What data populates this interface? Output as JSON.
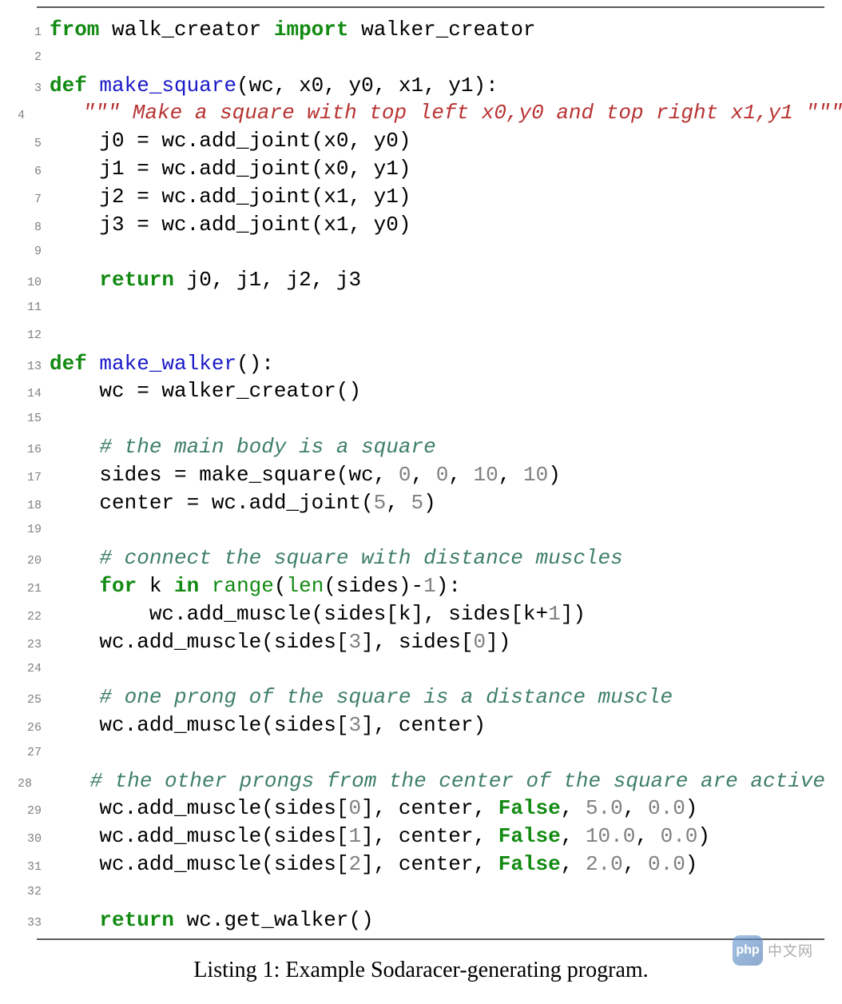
{
  "caption": "Listing 1: Example Sodaracer-generating program.",
  "watermark": {
    "icon_text": "php",
    "label": "中文网"
  },
  "code": [
    {
      "n": 1,
      "segs": [
        {
          "c": "kw-from",
          "t": "from"
        },
        {
          "c": "plain",
          "t": " walk_creator "
        },
        {
          "c": "kw-import",
          "t": "import"
        },
        {
          "c": "plain",
          "t": " walker_creator"
        }
      ]
    },
    {
      "n": 2,
      "segs": []
    },
    {
      "n": 3,
      "segs": [
        {
          "c": "kw-def",
          "t": "def"
        },
        {
          "c": "plain",
          "t": " "
        },
        {
          "c": "fn-name",
          "t": "make_square"
        },
        {
          "c": "plain",
          "t": "(wc, x0, y0, x1, y1):"
        }
      ]
    },
    {
      "n": 4,
      "segs": [
        {
          "c": "plain",
          "t": "    "
        },
        {
          "c": "docstr",
          "t": "\"\"\" Make a square with top left x0,y0 and top right x1,y1 \"\"\""
        }
      ]
    },
    {
      "n": 5,
      "segs": [
        {
          "c": "plain",
          "t": "    j0 = wc.add_joint(x0, y0)"
        }
      ]
    },
    {
      "n": 6,
      "segs": [
        {
          "c": "plain",
          "t": "    j1 = wc.add_joint(x0, y1)"
        }
      ]
    },
    {
      "n": 7,
      "segs": [
        {
          "c": "plain",
          "t": "    j2 = wc.add_joint(x1, y1)"
        }
      ]
    },
    {
      "n": 8,
      "segs": [
        {
          "c": "plain",
          "t": "    j3 = wc.add_joint(x1, y0)"
        }
      ]
    },
    {
      "n": 9,
      "segs": []
    },
    {
      "n": 10,
      "segs": [
        {
          "c": "plain",
          "t": "    "
        },
        {
          "c": "kw-return",
          "t": "return"
        },
        {
          "c": "plain",
          "t": " j0, j1, j2, j3"
        }
      ]
    },
    {
      "n": 11,
      "segs": []
    },
    {
      "n": 12,
      "segs": []
    },
    {
      "n": 13,
      "segs": [
        {
          "c": "kw-def",
          "t": "def"
        },
        {
          "c": "plain",
          "t": " "
        },
        {
          "c": "fn-name",
          "t": "make_walker"
        },
        {
          "c": "plain",
          "t": "():"
        }
      ]
    },
    {
      "n": 14,
      "segs": [
        {
          "c": "plain",
          "t": "    wc = walker_creator()"
        }
      ]
    },
    {
      "n": 15,
      "segs": []
    },
    {
      "n": 16,
      "segs": [
        {
          "c": "plain",
          "t": "    "
        },
        {
          "c": "comment",
          "t": "# the main body is a square"
        }
      ]
    },
    {
      "n": 17,
      "segs": [
        {
          "c": "plain",
          "t": "    sides = make_square(wc, "
        },
        {
          "c": "num",
          "t": "0"
        },
        {
          "c": "plain",
          "t": ", "
        },
        {
          "c": "num",
          "t": "0"
        },
        {
          "c": "plain",
          "t": ", "
        },
        {
          "c": "num",
          "t": "10"
        },
        {
          "c": "plain",
          "t": ", "
        },
        {
          "c": "num",
          "t": "10"
        },
        {
          "c": "plain",
          "t": ")"
        }
      ]
    },
    {
      "n": 18,
      "segs": [
        {
          "c": "plain",
          "t": "    center = wc.add_joint("
        },
        {
          "c": "num",
          "t": "5"
        },
        {
          "c": "plain",
          "t": ", "
        },
        {
          "c": "num",
          "t": "5"
        },
        {
          "c": "plain",
          "t": ")"
        }
      ]
    },
    {
      "n": 19,
      "segs": []
    },
    {
      "n": 20,
      "segs": [
        {
          "c": "plain",
          "t": "    "
        },
        {
          "c": "comment",
          "t": "# connect the square with distance muscles"
        }
      ]
    },
    {
      "n": 21,
      "segs": [
        {
          "c": "plain",
          "t": "    "
        },
        {
          "c": "kw-for",
          "t": "for"
        },
        {
          "c": "plain",
          "t": " k "
        },
        {
          "c": "kw-in",
          "t": "in"
        },
        {
          "c": "plain",
          "t": " "
        },
        {
          "c": "builtin",
          "t": "range"
        },
        {
          "c": "plain",
          "t": "("
        },
        {
          "c": "builtin",
          "t": "len"
        },
        {
          "c": "plain",
          "t": "(sides)-"
        },
        {
          "c": "num",
          "t": "1"
        },
        {
          "c": "plain",
          "t": "):"
        }
      ]
    },
    {
      "n": 22,
      "segs": [
        {
          "c": "plain",
          "t": "        wc.add_muscle(sides[k], sides[k+"
        },
        {
          "c": "num",
          "t": "1"
        },
        {
          "c": "plain",
          "t": "])"
        }
      ]
    },
    {
      "n": 23,
      "segs": [
        {
          "c": "plain",
          "t": "    wc.add_muscle(sides["
        },
        {
          "c": "num",
          "t": "3"
        },
        {
          "c": "plain",
          "t": "], sides["
        },
        {
          "c": "num",
          "t": "0"
        },
        {
          "c": "plain",
          "t": "])"
        }
      ]
    },
    {
      "n": 24,
      "segs": []
    },
    {
      "n": 25,
      "segs": [
        {
          "c": "plain",
          "t": "    "
        },
        {
          "c": "comment",
          "t": "# one prong of the square is a distance muscle"
        }
      ]
    },
    {
      "n": 26,
      "segs": [
        {
          "c": "plain",
          "t": "    wc.add_muscle(sides["
        },
        {
          "c": "num",
          "t": "3"
        },
        {
          "c": "plain",
          "t": "], center)"
        }
      ]
    },
    {
      "n": 27,
      "segs": []
    },
    {
      "n": 28,
      "segs": [
        {
          "c": "plain",
          "t": "    "
        },
        {
          "c": "comment",
          "t": "# the other prongs from the center of the square are active"
        }
      ]
    },
    {
      "n": 29,
      "segs": [
        {
          "c": "plain",
          "t": "    wc.add_muscle(sides["
        },
        {
          "c": "num",
          "t": "0"
        },
        {
          "c": "plain",
          "t": "], center, "
        },
        {
          "c": "kw-false",
          "t": "False"
        },
        {
          "c": "plain",
          "t": ", "
        },
        {
          "c": "num",
          "t": "5.0"
        },
        {
          "c": "plain",
          "t": ", "
        },
        {
          "c": "num",
          "t": "0.0"
        },
        {
          "c": "plain",
          "t": ")"
        }
      ]
    },
    {
      "n": 30,
      "segs": [
        {
          "c": "plain",
          "t": "    wc.add_muscle(sides["
        },
        {
          "c": "num",
          "t": "1"
        },
        {
          "c": "plain",
          "t": "], center, "
        },
        {
          "c": "kw-false",
          "t": "False"
        },
        {
          "c": "plain",
          "t": ", "
        },
        {
          "c": "num",
          "t": "10.0"
        },
        {
          "c": "plain",
          "t": ", "
        },
        {
          "c": "num",
          "t": "0.0"
        },
        {
          "c": "plain",
          "t": ")"
        }
      ]
    },
    {
      "n": 31,
      "segs": [
        {
          "c": "plain",
          "t": "    wc.add_muscle(sides["
        },
        {
          "c": "num",
          "t": "2"
        },
        {
          "c": "plain",
          "t": "], center, "
        },
        {
          "c": "kw-false",
          "t": "False"
        },
        {
          "c": "plain",
          "t": ", "
        },
        {
          "c": "num",
          "t": "2.0"
        },
        {
          "c": "plain",
          "t": ", "
        },
        {
          "c": "num",
          "t": "0.0"
        },
        {
          "c": "plain",
          "t": ")"
        }
      ]
    },
    {
      "n": 32,
      "segs": []
    },
    {
      "n": 33,
      "segs": [
        {
          "c": "plain",
          "t": "    "
        },
        {
          "c": "kw-return",
          "t": "return"
        },
        {
          "c": "plain",
          "t": " wc.get_walker()"
        }
      ]
    }
  ]
}
